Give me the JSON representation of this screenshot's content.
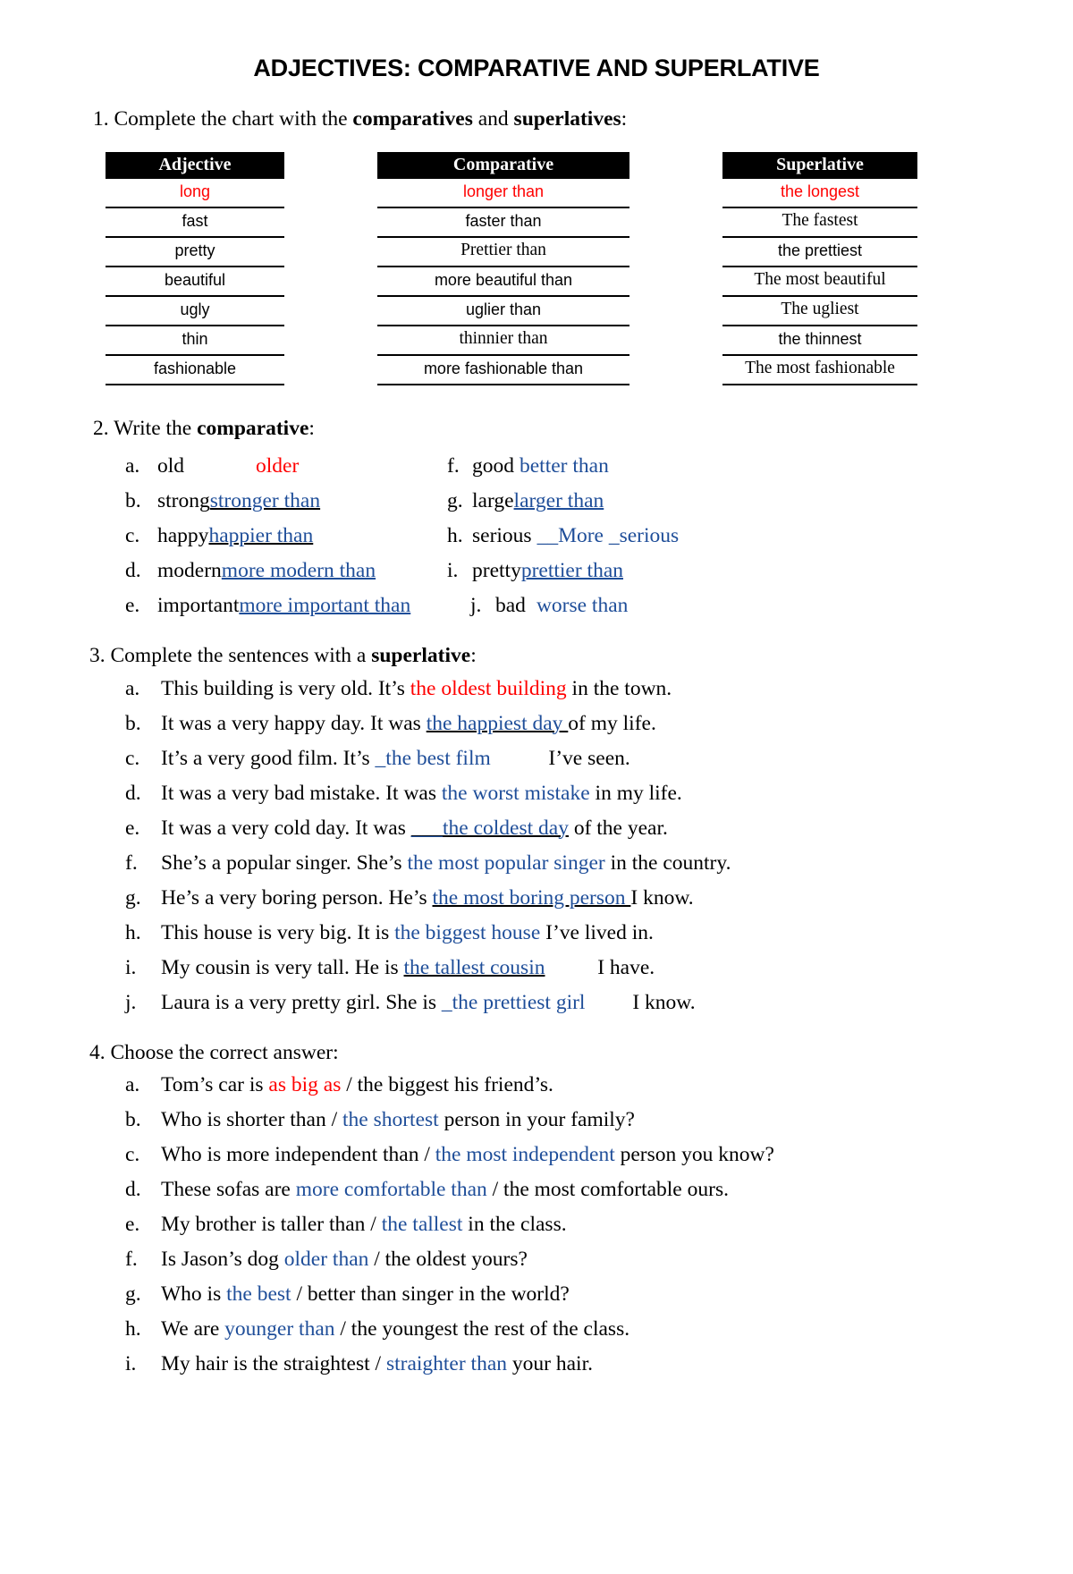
{
  "document": {
    "title": "ADJECTIVES: COMPARATIVE AND SUPERLATIVE"
  },
  "colors": {
    "example_red": "#ff0000",
    "answer_blue": "#1f4e99",
    "header_bar": "#000000"
  },
  "exercise1": {
    "instruction_prefix": "1. Complete the chart with the ",
    "instruction_bold1": "comparatives",
    "instruction_mid": " and ",
    "instruction_bold2": "superlatives",
    "instruction_suffix": ":",
    "headers": [
      "Adjective",
      "Comparative",
      "Superlative"
    ],
    "rows": [
      {
        "adjective": "long",
        "comparative": "longer than",
        "superlative": "the longest",
        "style": "red-sans"
      },
      {
        "adjective": "fast",
        "comparative": "faster than",
        "superlative": "The fastest",
        "style": "sans-sans-serif"
      },
      {
        "adjective": "pretty",
        "comparative": "Prettier than",
        "superlative": "the prettiest",
        "style": "sans-serif-sans"
      },
      {
        "adjective": "beautiful",
        "comparative": "more beautiful than",
        "superlative": "The most beautiful",
        "style": "sans-sans-serif"
      },
      {
        "adjective": "ugly",
        "comparative": "uglier than",
        "superlative": "The ugliest",
        "style": "sans-sans-serif"
      },
      {
        "adjective": "thin",
        "comparative": "thinnier than",
        "superlative": "the thinnest",
        "style": "sans-serif-sans"
      },
      {
        "adjective": "fashionable",
        "comparative": "more fashionable than",
        "superlative": "The most fashionable",
        "style": "sans-sans-serif"
      }
    ]
  },
  "exercise2": {
    "instruction_prefix": "2. Write the ",
    "instruction_bold": "comparative",
    "instruction_suffix": ":",
    "items_left": [
      {
        "label": "a.",
        "word": "old",
        "answer": "older",
        "answer_color": "red",
        "underline": "none",
        "gap": "wide"
      },
      {
        "label": "b.",
        "word": "strong",
        "answer": " stronger than ",
        "answer_color": "blue",
        "underline": "black"
      },
      {
        "label": "c.",
        "word": "happy",
        "answer": " happier than ",
        "answer_color": "blue",
        "underline": "black"
      },
      {
        "label": "d.",
        "word": "modern",
        "answer": " more modern than",
        "answer_color": "blue",
        "underline": "blue"
      },
      {
        "label": "e.",
        "word": "important",
        "answer": " more important than",
        "answer_color": "blue",
        "underline": "blue"
      }
    ],
    "items_right": [
      {
        "label": "f.",
        "word": "good",
        "answer": "better than",
        "answer_color": "blue",
        "underline": "none"
      },
      {
        "label": "g.",
        "word": "large",
        "answer": " larger than",
        "answer_color": "blue",
        "underline": "blue",
        "trailing_blank": "________"
      },
      {
        "label": "h.",
        "word": "serious",
        "answer": "__More _serious ",
        "answer_color": "blue",
        "underline": "none",
        "trailing_blank": "____"
      },
      {
        "label": "i.",
        "word": "pretty",
        "answer": " prettier than",
        "answer_color": "blue",
        "underline": "blue",
        "trailing_blank": "_______"
      },
      {
        "label": "j.",
        "word": "bad",
        "answer": "worse than",
        "answer_color": "blue",
        "underline": "none"
      }
    ]
  },
  "exercise3": {
    "instruction_prefix": "3. Complete the sentences with a ",
    "instruction_bold": "superlative",
    "instruction_suffix": ":",
    "items": [
      {
        "label": "a.",
        "before": "This building is very old. It’s ",
        "answer": "the oldest building",
        "after": " in the town.",
        "answer_color": "red",
        "underline": "none"
      },
      {
        "label": "b.",
        "before": "It was a very happy day. It was ",
        "answer": " the happiest day ",
        "after": "of my life.",
        "answer_color": "blue",
        "underline": "black"
      },
      {
        "label": "c.",
        "before": "It’s a very good film. It’s ",
        "answer": "_the best film",
        "after": " I’ve seen.",
        "answer_color": "blue",
        "underline": "none",
        "trailing_blank": "_____"
      },
      {
        "label": "d.",
        "before": "It was a very bad mistake. It was ",
        "answer": " the worst mistake",
        "after": " in my life.",
        "answer_color": "blue",
        "underline": "none"
      },
      {
        "label": "e.",
        "before": "It was a very cold day. It was ",
        "answer": "___the coldest day",
        "after": " of the year.",
        "answer_color": "blue",
        "underline": "black-partial"
      },
      {
        "label": "f.",
        "before": "She’s a popular singer. She’s ",
        "answer": " the most popular singer",
        "after": " in the country.",
        "answer_color": "blue",
        "underline": "none"
      },
      {
        "label": "g.",
        "before": "He’s a very boring person. He’s ",
        "answer": " the most boring person ",
        "after": "I know.",
        "answer_color": "blue",
        "underline": "black"
      },
      {
        "label": "h.",
        "before": "This house is very big. It is ",
        "answer": " the biggest house ",
        "after": " I’ve lived in.",
        "answer_color": "blue",
        "underline": "none"
      },
      {
        "label": "i.",
        "before": "My cousin is very tall. He is ",
        "answer": " the tallest cousin",
        "after": "I have.",
        "answer_color": "blue",
        "underline": "black",
        "trailing_blank": "_____"
      },
      {
        "label": "j.",
        "before": "Laura is a very pretty girl. She is ",
        "answer": " _the prettiest girl",
        "after": " I know.",
        "answer_color": "blue",
        "underline": "none",
        "trailing_blank": "____"
      }
    ]
  },
  "exercise4": {
    "instruction": "4. Choose the correct answer:",
    "items": [
      {
        "label": "a.",
        "before": "Tom’s car is ",
        "choice": "as big as",
        "after": " / the biggest his friend’s.",
        "choice_color": "red"
      },
      {
        "label": "b.",
        "before": "Who is shorter than / ",
        "choice": "the shortest",
        "after": " person in your family?",
        "choice_color": "blue"
      },
      {
        "label": "c.",
        "before": "Who is more independent than / ",
        "choice": "the most independent",
        "after": " person you know?",
        "choice_color": "blue"
      },
      {
        "label": "d.",
        "before": "These sofas are ",
        "choice": "more comfortable than",
        "after": " / the most comfortable ours.",
        "choice_color": "blue"
      },
      {
        "label": "e.",
        "before": "My brother is taller than / ",
        "choice": "the tallest",
        "after": " in the class.",
        "choice_color": "blue"
      },
      {
        "label": "f.",
        "before": "Is Jason’s dog ",
        "choice": "older than",
        "after": " / the oldest yours?",
        "choice_color": "blue"
      },
      {
        "label": "g.",
        "before": "Who is ",
        "choice": "the best",
        "after": " / better than singer in the world?",
        "choice_color": "blue"
      },
      {
        "label": "h.",
        "before": "We are ",
        "choice": "younger than",
        "after": " / the youngest the rest of the class.",
        "choice_color": "blue"
      },
      {
        "label": "i.",
        "before": "My hair is the straightest / ",
        "choice": "straighter than",
        "after": " your hair.",
        "choice_color": "blue"
      }
    ]
  }
}
